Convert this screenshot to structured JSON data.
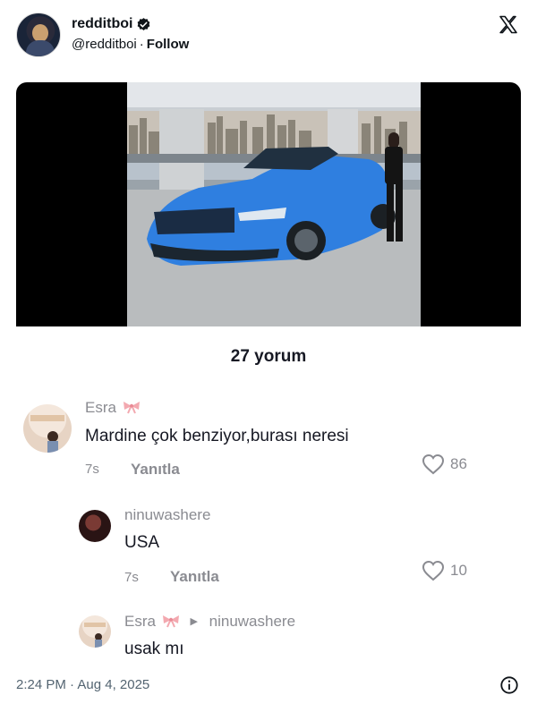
{
  "tweet": {
    "display_name": "redditboi",
    "handle": "@redditboi",
    "separator": "·",
    "follow_label": "Follow",
    "timestamp": "2:24 PM · Aug 4, 2025"
  },
  "comments_panel": {
    "title": "27 yorum",
    "comments": [
      {
        "author": "Esra",
        "text": "Mardine çok benziyor,burası neresi",
        "time": "7s",
        "reply_label": "Yanıtla",
        "likes": "86"
      },
      {
        "author": "ninuwashere",
        "text": "USA",
        "time": "7s",
        "reply_label": "Yanıtla",
        "likes": "10"
      },
      {
        "author": "Esra",
        "reply_to": "ninuwashere",
        "text": "usak mı"
      }
    ]
  },
  "colors": {
    "car": "#2f7fe0",
    "muted_text": "#8a8b91",
    "verified": "#0f1419"
  },
  "icons": [
    "verified-icon",
    "x-logo-icon",
    "heart-icon",
    "bow-icon",
    "info-icon"
  ]
}
